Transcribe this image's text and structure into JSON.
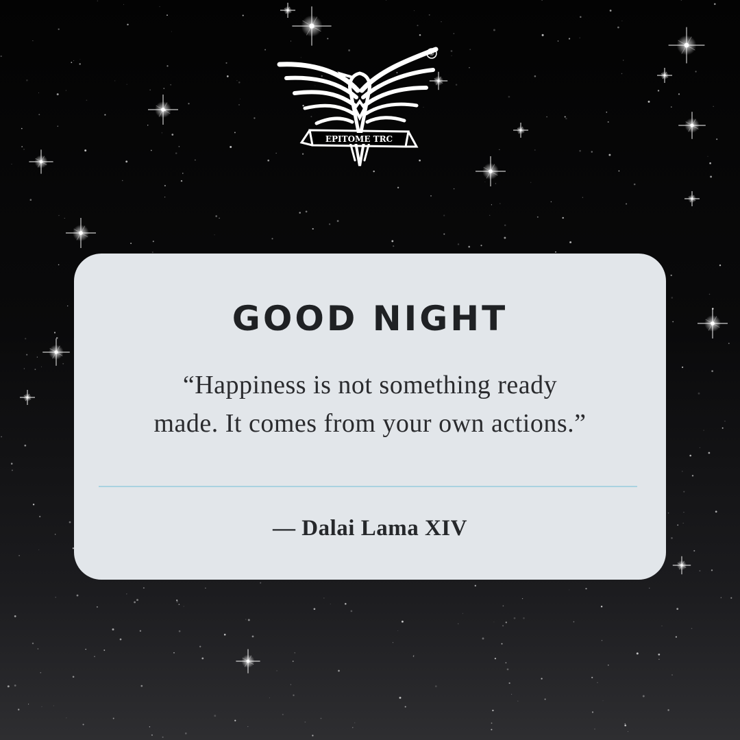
{
  "logo": {
    "text": "EPITOME TRC",
    "mark": "®"
  },
  "card": {
    "title": "GOOD NIGHT",
    "quote_line1": "“Happiness is not something ready",
    "quote_line2": "made. It comes from your own actions.”",
    "author": "— Dalai Lama XIV"
  },
  "colors": {
    "background": "#050505",
    "card": "#e2e6ea",
    "divider": "#a9d2e1",
    "text": "#1f2124"
  }
}
